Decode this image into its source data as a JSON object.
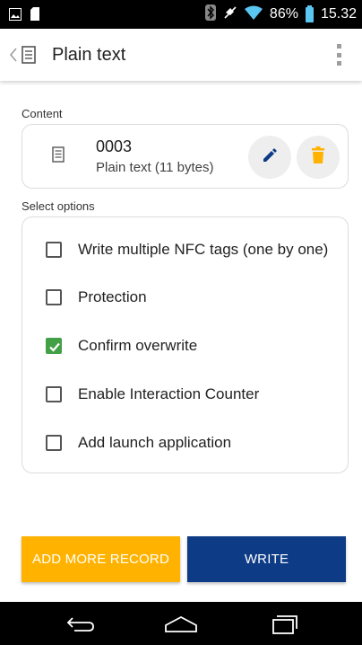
{
  "status_bar": {
    "battery_percent": "86%",
    "time": "15.32",
    "icons": [
      "photo-icon",
      "sim-icon",
      "bluetooth-icon",
      "mute-icon",
      "wifi-icon",
      "battery-icon"
    ]
  },
  "app_bar": {
    "title": "Plain text",
    "icons": [
      "back-icon",
      "document-icon",
      "overflow-menu-icon"
    ]
  },
  "content": {
    "label": "Content",
    "record": {
      "title": "0003",
      "subtitle": "Plain text (11 bytes)",
      "icon": "document-icon",
      "actions": [
        "edit-icon",
        "delete-icon"
      ]
    }
  },
  "options": {
    "label": "Select options",
    "items": [
      {
        "label": "Write multiple NFC tags (one by one)",
        "checked": false
      },
      {
        "label": "Protection",
        "checked": false
      },
      {
        "label": "Confirm overwrite",
        "checked": true
      },
      {
        "label": "Enable Interaction Counter",
        "checked": false
      },
      {
        "label": "Add launch application",
        "checked": false
      }
    ]
  },
  "buttons": {
    "add_more": "ADD MORE RECORD",
    "write": "WRITE"
  },
  "colors": {
    "accent_yellow": "#ffb300",
    "accent_blue": "#0d3b85",
    "check_green": "#43a047",
    "edit_blue": "#0d3b85"
  },
  "nav_bar": {
    "icons": [
      "back-icon",
      "home-icon",
      "recents-icon"
    ]
  }
}
